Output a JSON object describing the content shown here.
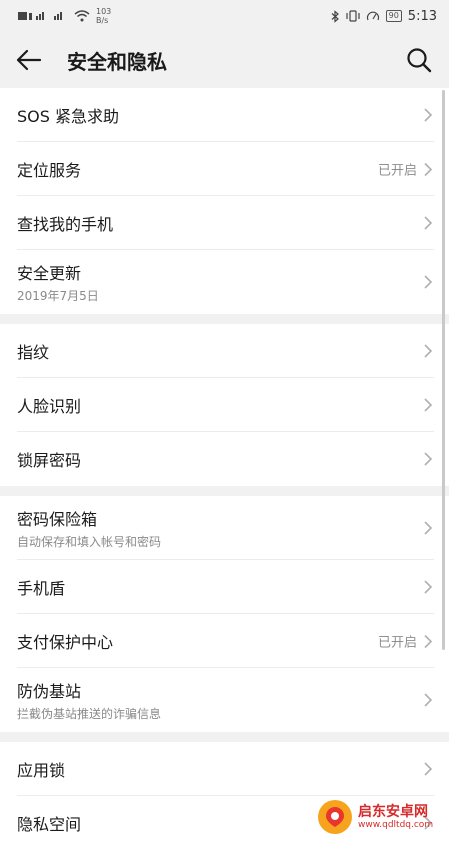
{
  "status_bar": {
    "network_rate_value": "103",
    "network_rate_unit": "B/s",
    "battery": "90",
    "time": "5:13"
  },
  "header": {
    "title": "安全和隐私"
  },
  "groups": [
    {
      "items": [
        {
          "label": "SOS 紧急求助"
        },
        {
          "label": "定位服务",
          "status": "已开启"
        },
        {
          "label": "查找我的手机"
        },
        {
          "label": "安全更新",
          "sub": "2019年7月5日"
        }
      ]
    },
    {
      "items": [
        {
          "label": "指纹"
        },
        {
          "label": "人脸识别"
        },
        {
          "label": "锁屏密码"
        }
      ]
    },
    {
      "items": [
        {
          "label": "密码保险箱",
          "sub": "自动保存和填入帐号和密码"
        },
        {
          "label": "手机盾"
        },
        {
          "label": "支付保护中心",
          "status": "已开启"
        },
        {
          "label": "防伪基站",
          "sub": "拦截伪基站推送的诈骗信息"
        }
      ]
    },
    {
      "items": [
        {
          "label": "应用锁"
        },
        {
          "label": "隐私空间"
        }
      ]
    }
  ],
  "watermark": {
    "title": "启东安卓网",
    "url": "www.qdltdq.com"
  }
}
